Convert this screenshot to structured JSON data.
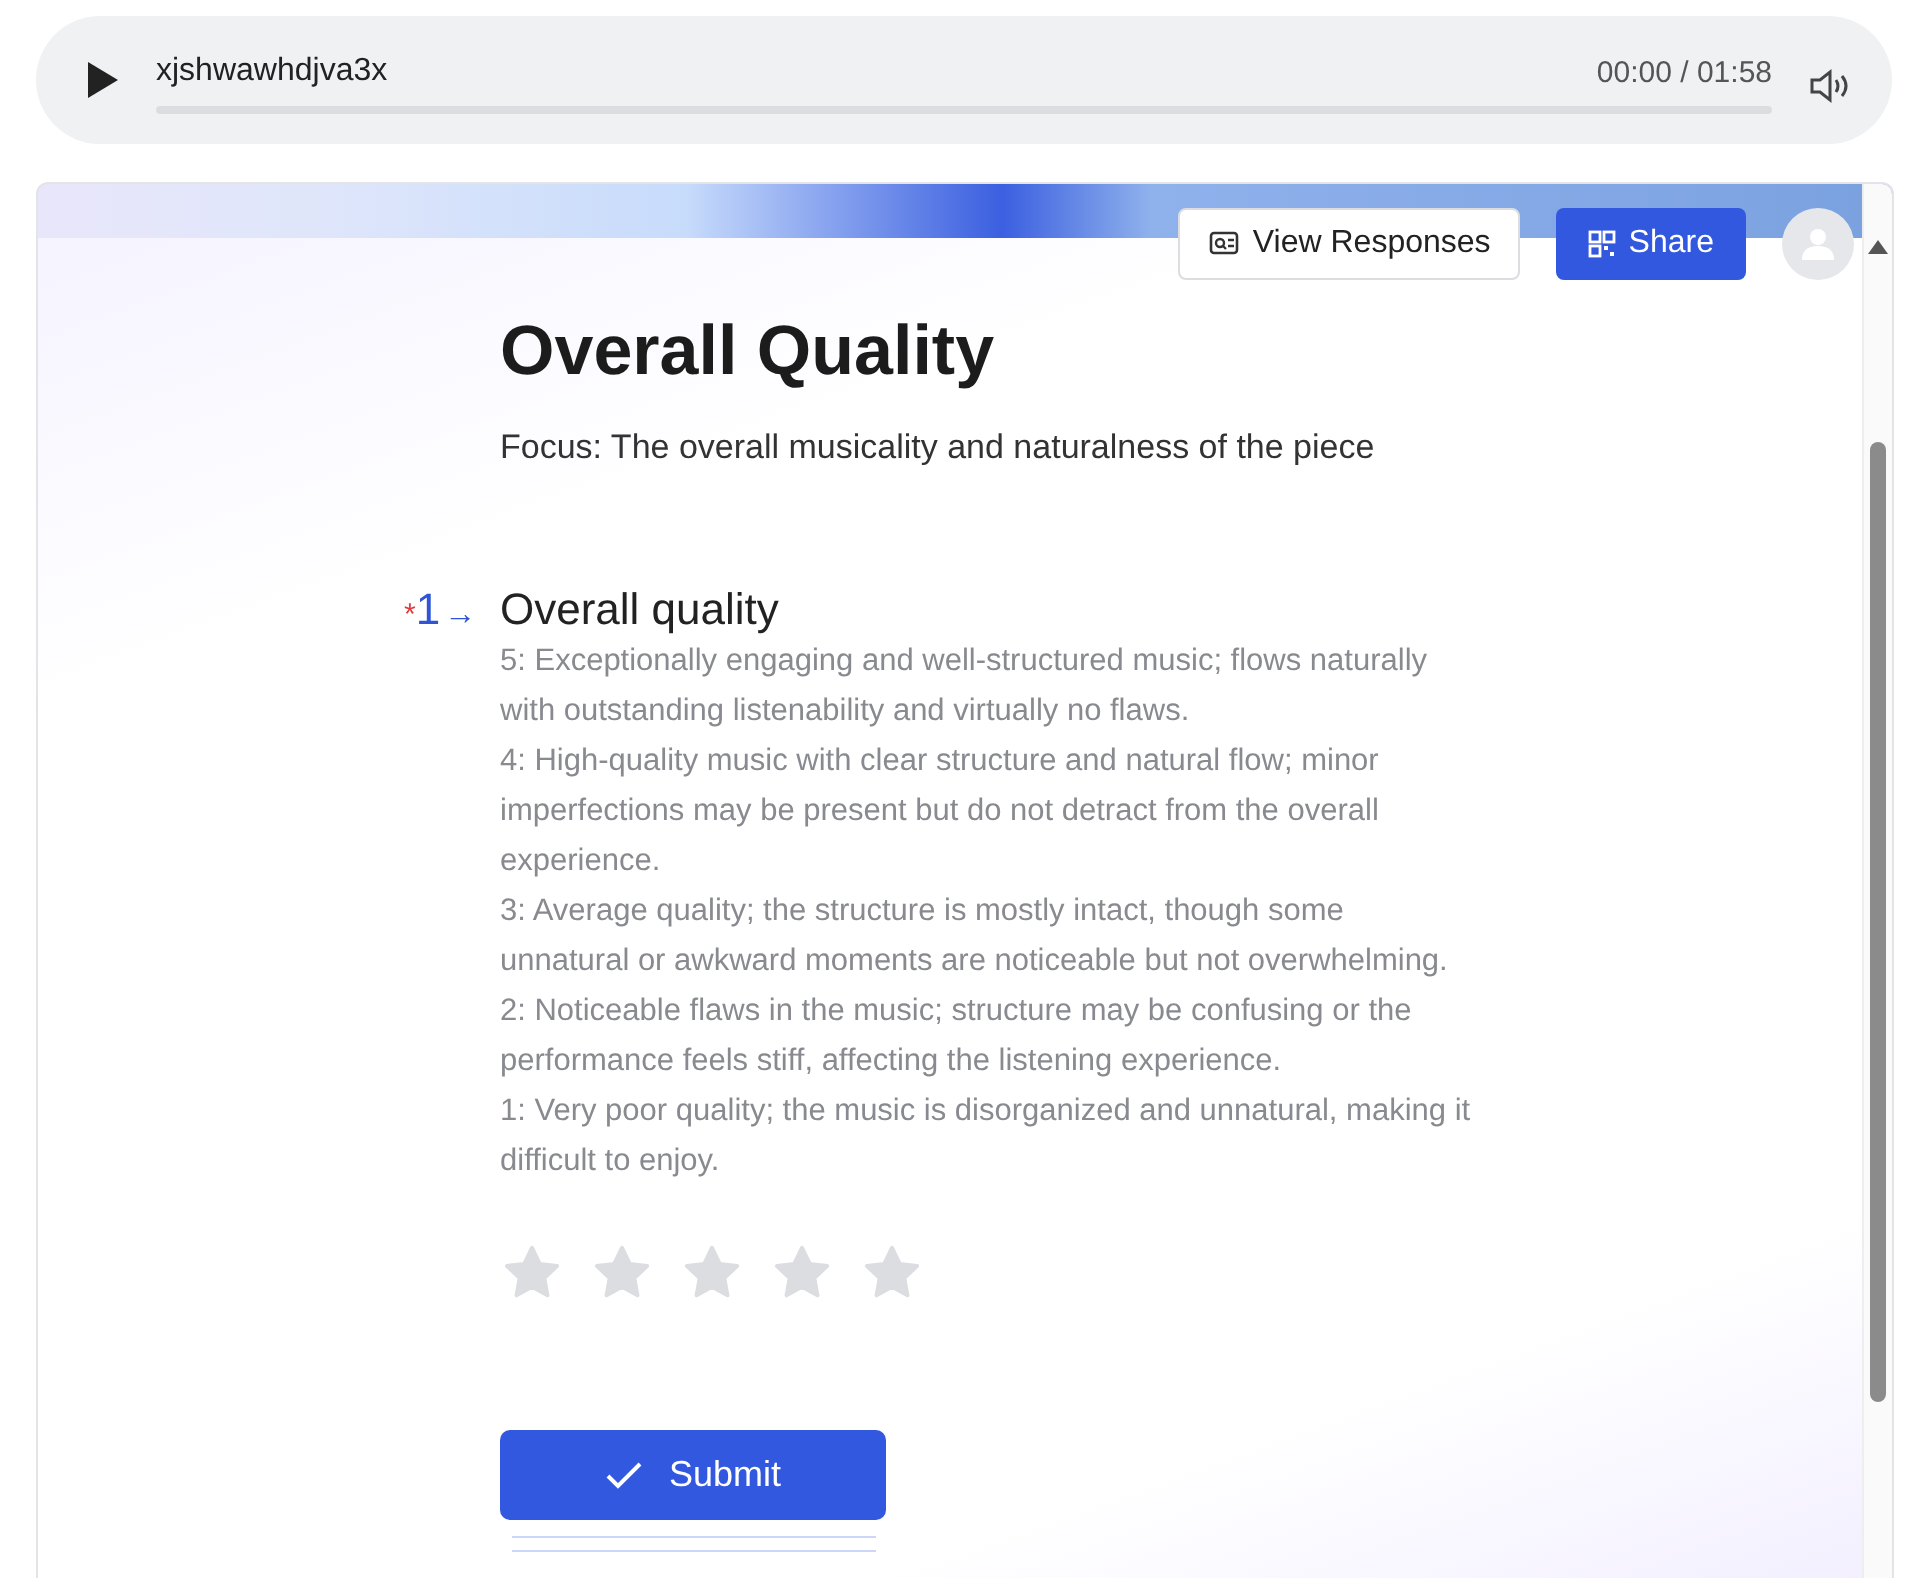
{
  "player": {
    "file_name": "xjshwawhdjva3x",
    "time": "00:00 / 01:58"
  },
  "header": {
    "view_responses": "View Responses",
    "share": "Share"
  },
  "section": {
    "title": "Overall Quality",
    "focus": "Focus: The overall musicality and naturalness of the piece"
  },
  "question": {
    "required_mark": "*",
    "number": "1",
    "arrow": "→",
    "title": "Overall quality",
    "descriptions": [
      "5: Exceptionally engaging and well-structured music; flows naturally with outstanding listenability and virtually no flaws.",
      "4: High-quality music with clear structure and natural flow; minor imperfections may be present but do not detract from the overall experience.",
      "3: Average quality; the structure is mostly intact, though some unnatural or awkward moments are noticeable but not overwhelming.",
      "2: Noticeable flaws in the music; structure may be confusing or the performance feels stiff, affecting the listening experience.",
      "1: Very poor quality; the music is disorganized and unnatural, making it difficult to enjoy."
    ],
    "stars": 0
  },
  "submit": "Submit"
}
